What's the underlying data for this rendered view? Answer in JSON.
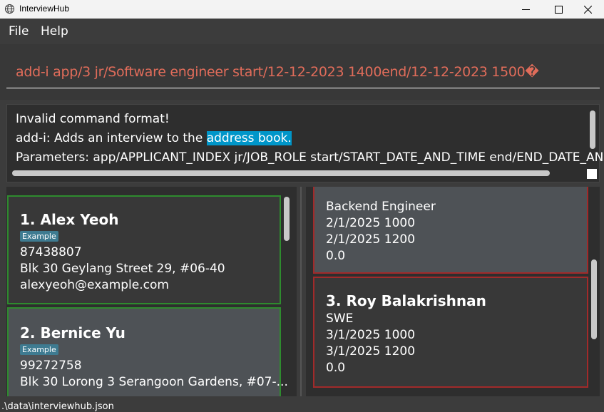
{
  "window": {
    "title": "InterviewHub"
  },
  "menu": {
    "file": "File",
    "help": "Help"
  },
  "command": {
    "value": "add-i app/3 jr/Software engineer start/12-12-2023 1400end/12-12-2023 1500�"
  },
  "result": {
    "line1": "Invalid command format!",
    "line2_prefix": "add-i: Adds an interview to the ",
    "line2_highlight": "address book.",
    "line3": "Parameters: app/APPLICANT_INDEX jr/JOB_ROLE start/START_DATE_AND_TIME end/END_DATE_AND_"
  },
  "applicants": [
    {
      "name": "1.  Alex Yeoh",
      "tag": "Example",
      "phone": "87438807",
      "address": "Blk 30 Geylang Street 29, #06-40",
      "email": "alexyeoh@example.com"
    },
    {
      "name": "2.  Bernice Yu",
      "tag": "Example",
      "phone": "99272758",
      "address": "Blk 30 Lorong 3 Serangoon Gardens, #07-..."
    }
  ],
  "interviews": [
    {
      "job_role": "Backend Engineer",
      "start": "2/1/2025 1000",
      "end": "2/1/2025 1200",
      "rating": "0.0"
    },
    {
      "name": "3.  Roy Balakrishnan",
      "job_role": "SWE",
      "start": "3/1/2025 1000",
      "end": "3/1/2025 1200",
      "rating": "0.0"
    }
  ],
  "status": {
    "path": ".\\data\\interviewhub.json"
  },
  "colors": {
    "applicant_border": "#2e8b2e",
    "interview_border": "#a12a2a",
    "command_text": "#e06c5a",
    "highlight": "#0096c9",
    "tag": "#3e7b91"
  }
}
